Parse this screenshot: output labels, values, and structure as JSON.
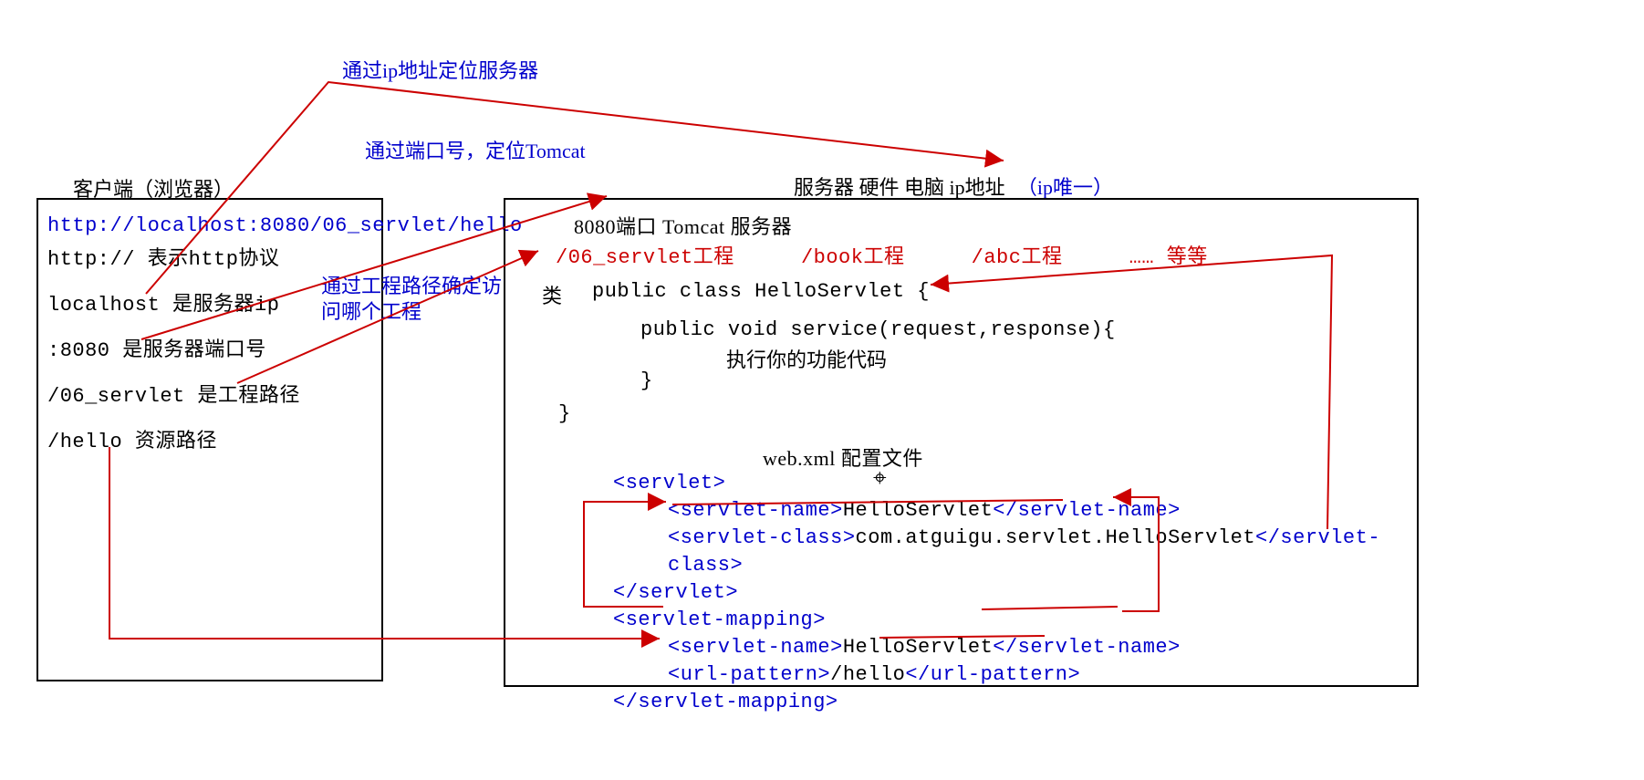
{
  "labels": {
    "via_ip": "通过ip地址定位服务器",
    "via_port": "通过端口号，定位Tomcat",
    "via_path": "通过工程路径确定访问哪个工程"
  },
  "client": {
    "title": "客户端（浏览器）",
    "url": "http://localhost:8080/06_servlet/hello",
    "l1": "http:// 表示http协议",
    "l2": "localhost 是服务器ip",
    "l3": ":8080 是服务器端口号",
    "l4": "/06_servlet 是工程路径",
    "l5": "/hello  资源路径"
  },
  "server": {
    "title_black": "服务器 硬件 电脑  ip地址",
    "title_blue": "（ip唯一）",
    "port_line": "8080端口 Tomcat 服务器",
    "projects": {
      "p1": "/06_servlet工程",
      "p2": "/book工程",
      "p3": "/abc工程",
      "p4": "…… 等等"
    },
    "class_label": "类",
    "code": {
      "l1": "public class HelloServlet {",
      "l2": "public void service(request,response){",
      "l3": "执行你的功能代码",
      "l4": "}",
      "l5": "}"
    },
    "webxml_title": "web.xml 配置文件",
    "xml": {
      "l1": "<servlet>",
      "l2_a": "<servlet-name>",
      "l2_b": "HelloServlet",
      "l2_c": "</servlet-name>",
      "l3_a": "<servlet-class>",
      "l3_b": "com.atguigu.servlet.HelloServlet",
      "l3_c": "</servlet-class>",
      "l4": "</servlet>",
      "l5": "<servlet-mapping>",
      "l6_a": "<servlet-name>",
      "l6_b": "HelloServlet",
      "l6_c": "</servlet-name>",
      "l7_a": "<url-pattern>",
      "l7_b": "/hello",
      "l7_c": "</url-pattern>",
      "l8": "</servlet-mapping>"
    }
  }
}
